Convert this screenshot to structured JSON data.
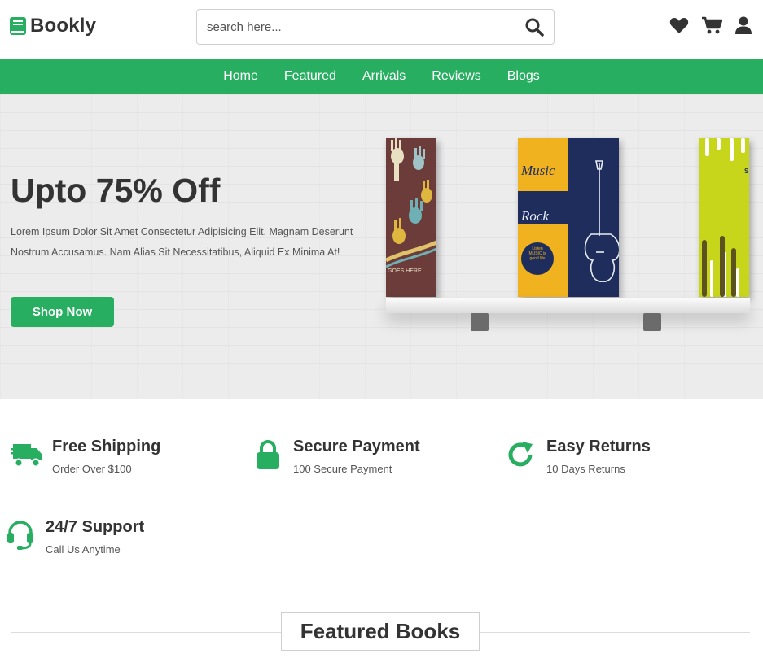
{
  "brand": {
    "name": "Bookly",
    "color": "#27ae60"
  },
  "search": {
    "placeholder": "search here..."
  },
  "header_icons": [
    "heart-icon",
    "cart-icon",
    "user-icon"
  ],
  "nav": {
    "items": [
      {
        "label": "Home"
      },
      {
        "label": "Featured"
      },
      {
        "label": "Arrivals"
      },
      {
        "label": "Reviews"
      },
      {
        "label": "Blogs"
      }
    ]
  },
  "hero": {
    "title": "Upto 75% Off",
    "description": "Lorem Ipsum Dolor Sit Amet Consectetur Adipisicing Elit. Magnam Deserunt Nostrum Accusamus. Nam Alias Sit Necessitatibus, Aliquid Ex Minima At!",
    "button_label": "Shop Now",
    "books": [
      {
        "caption": "GOES HERE"
      },
      {
        "title1": "Music",
        "title2": "Rock",
        "badge": "Listen MUSIC is good life"
      },
      {
        "caption": "S"
      }
    ]
  },
  "features": [
    {
      "icon": "truck-icon",
      "title": "Free Shipping",
      "subtitle": "Order Over $100"
    },
    {
      "icon": "lock-icon",
      "title": "Secure Payment",
      "subtitle": "100 Secure Payment"
    },
    {
      "icon": "redo-icon",
      "title": "Easy Returns",
      "subtitle": "10 Days Returns"
    },
    {
      "icon": "headset-icon",
      "title": "24/7 Support",
      "subtitle": "Call Us Anytime"
    }
  ],
  "featured": {
    "heading": "Featured Books"
  }
}
